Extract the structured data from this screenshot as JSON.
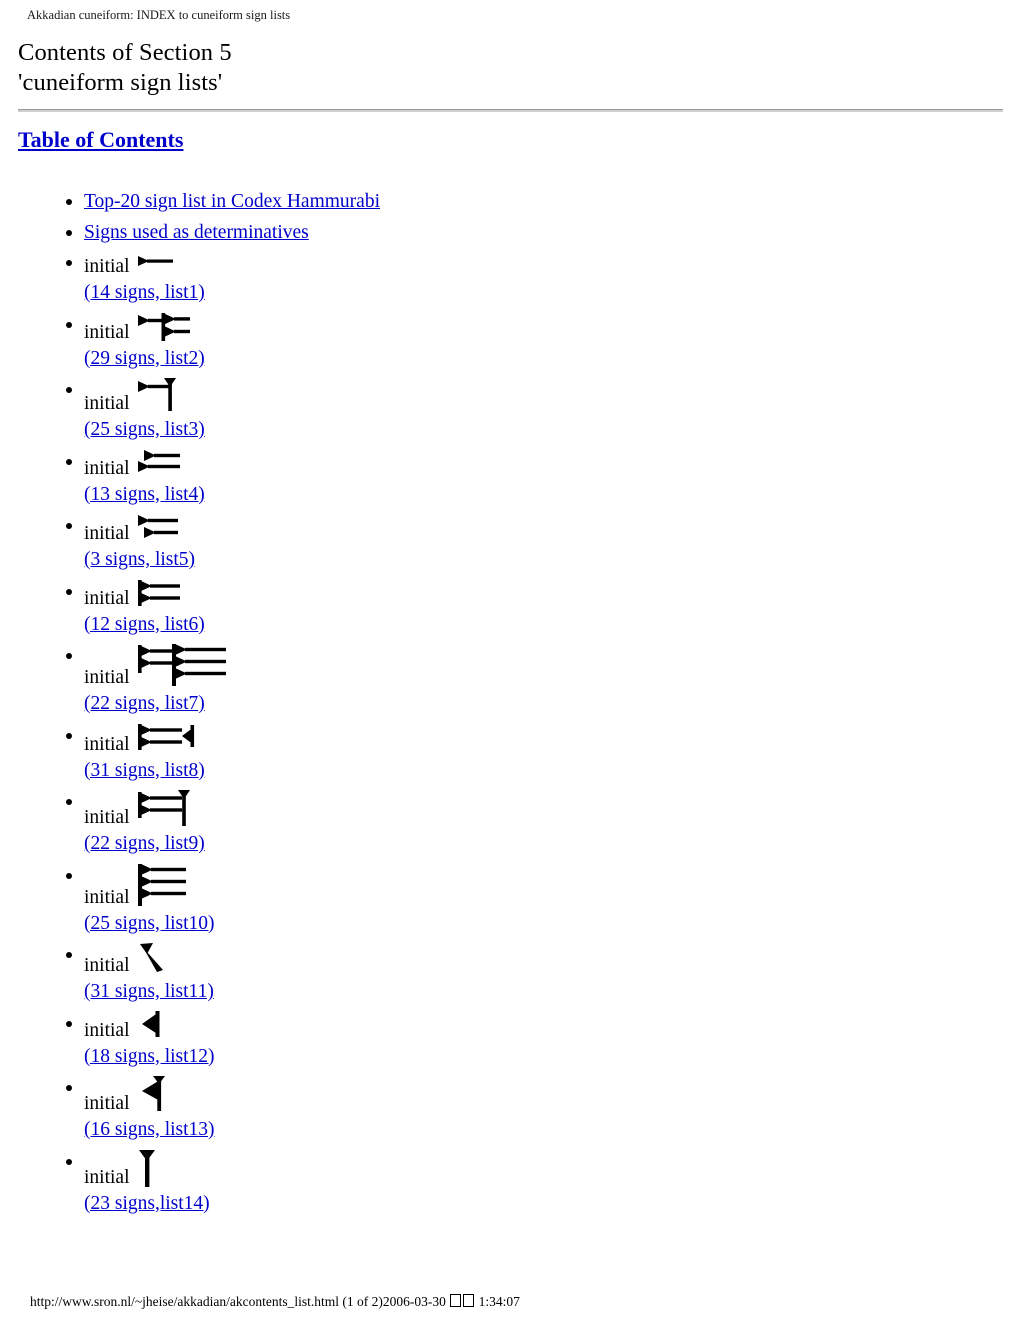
{
  "document": {
    "header_text": "Akkadian cuneiform: INDEX to cuneiform sign lists",
    "title_line1": "Contents of Section 5",
    "title_line2": "'cuneiform sign lists'",
    "toc_heading": "Table of Contents"
  },
  "colors": {
    "link": "#0000cc",
    "text": "#000000",
    "background": "#ffffff",
    "rule": "#9a9a9a"
  },
  "toc": {
    "items": [
      {
        "type": "link",
        "label": "Top-20 sign list in Codex Hammurabi"
      },
      {
        "type": "link",
        "label": "Signs used as determinatives "
      },
      {
        "type": "glyph",
        "prefix": "initial",
        "glyph": "cuneiform-sign-1",
        "link": "(14 signs, list1) "
      },
      {
        "type": "glyph",
        "prefix": "initial",
        "glyph": "cuneiform-sign-2",
        "link": "(29 signs, list2) "
      },
      {
        "type": "glyph",
        "prefix": "initial",
        "glyph": "cuneiform-sign-3",
        "link": "(25 signs, list3)"
      },
      {
        "type": "glyph",
        "prefix": "initial",
        "glyph": "cuneiform-sign-4",
        "link": "(13 signs, list4)"
      },
      {
        "type": "glyph",
        "prefix": "initial",
        "glyph": "cuneiform-sign-5",
        "link": "(3 signs, list5)"
      },
      {
        "type": "glyph",
        "prefix": "initial",
        "glyph": "cuneiform-sign-6",
        "link": "(12 signs, list6)"
      },
      {
        "type": "glyph",
        "prefix": "initial",
        "glyph": "cuneiform-sign-7",
        "link": "(22 signs, list7)"
      },
      {
        "type": "glyph",
        "prefix": "initial",
        "glyph": "cuneiform-sign-8",
        "link": "(31 signs, list8)"
      },
      {
        "type": "glyph",
        "prefix": "initial",
        "glyph": "cuneiform-sign-9",
        "link": "(22 signs, list9)"
      },
      {
        "type": "glyph",
        "prefix": "initial",
        "glyph": "cuneiform-sign-10",
        "link": "(25 signs, list10)"
      },
      {
        "type": "glyph",
        "prefix": "initial",
        "glyph": "cuneiform-sign-11",
        "link": "(31 signs, list11)"
      },
      {
        "type": "glyph",
        "prefix": "initial",
        "glyph": "cuneiform-sign-12",
        "link": "(18 signs, list12)"
      },
      {
        "type": "glyph",
        "prefix": "initial",
        "glyph": "cuneiform-sign-13",
        "link": "(16 signs, list13) "
      },
      {
        "type": "glyph",
        "prefix": "initial",
        "glyph": "cuneiform-sign-14",
        "link": "(23 signs,list14) "
      }
    ]
  },
  "footer": {
    "url": "http://www.sron.nl/~jheise/akkadian/akcontents_list.html",
    "pagination": "(1 of 2)",
    "date": "2006-03-30",
    "missing_glyphs": "□□",
    "time": "1:34:07"
  }
}
